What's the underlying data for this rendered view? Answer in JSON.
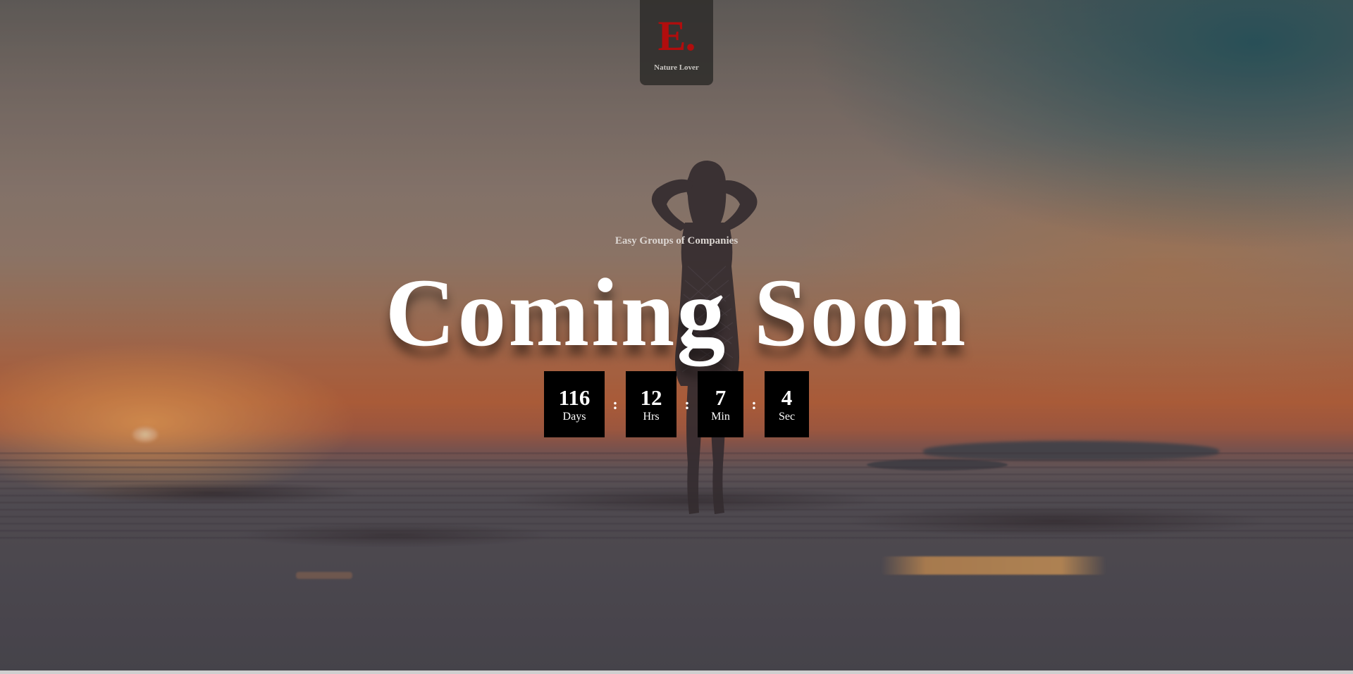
{
  "brand": {
    "logo_mark": "E.",
    "logo_name": "Nature Lover"
  },
  "hero": {
    "tagline": "Easy Groups of Companies",
    "headline": "Coming Soon"
  },
  "countdown": {
    "days": {
      "value": "116",
      "unit": "Days"
    },
    "hours": {
      "value": "12",
      "unit": "Hrs"
    },
    "minutes": {
      "value": "7",
      "unit": "Min"
    },
    "seconds": {
      "value": "4",
      "unit": "Sec"
    },
    "separator": ":"
  },
  "colors": {
    "logo_accent": "#b10d0d",
    "countdown_box": "#000000",
    "headline_text": "#ffffff"
  }
}
